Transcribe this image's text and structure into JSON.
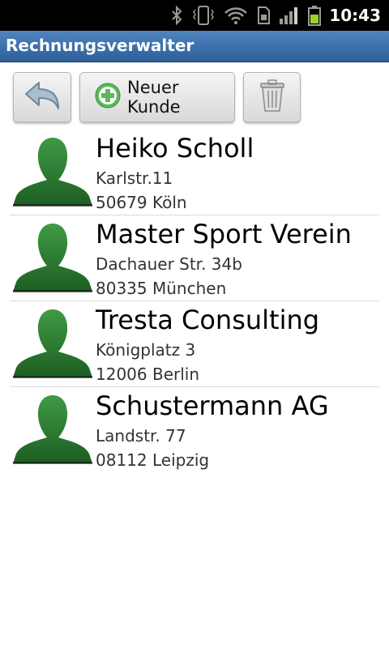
{
  "statusbar": {
    "time": "10:43",
    "icons": [
      "bluetooth-icon",
      "vibrate-icon",
      "wifi-icon",
      "sim-icon",
      "signal-icon",
      "battery-icon"
    ]
  },
  "app": {
    "title": "Rechnungsverwalter"
  },
  "toolbar": {
    "back_icon": "back-arrow-icon",
    "new_label": "Neuer Kunde",
    "new_icon": "plus-circle-icon",
    "delete_icon": "trash-icon"
  },
  "customers": [
    {
      "name": "Heiko Scholl",
      "street": "Karlstr.11",
      "city": "50679 Köln"
    },
    {
      "name": "Master Sport Verein",
      "street": "Dachauer Str. 34b",
      "city": "80335 München"
    },
    {
      "name": "Tresta Consulting",
      "street": "Königplatz 3",
      "city": "12006 Berlin"
    },
    {
      "name": "Schustermann AG",
      "street": "Landstr. 77",
      "city": "08112 Leipzig"
    }
  ],
  "colors": {
    "titlebar": "#3f74ae",
    "avatar": "#2e7d32",
    "add_icon": "#5cb85c"
  }
}
